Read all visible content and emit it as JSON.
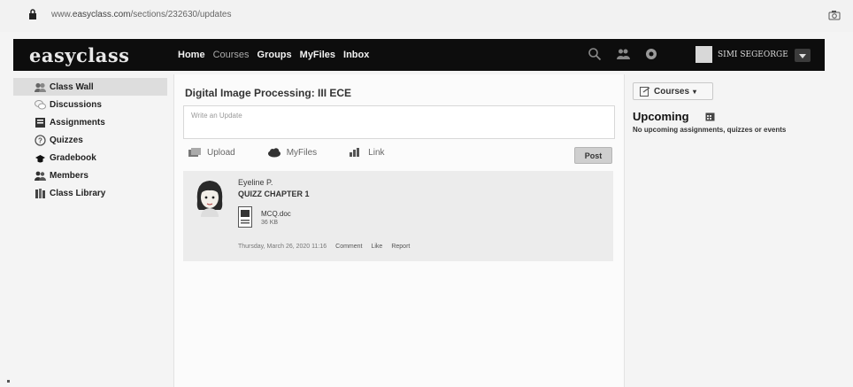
{
  "browser": {
    "url_prefix": "www.",
    "url_domain": "easyclass.com",
    "url_path": "/sections/232630/updates"
  },
  "navbar": {
    "logo": "easyclass",
    "links": [
      "Home",
      "Courses",
      "Groups",
      "MyFiles",
      "Inbox"
    ],
    "user_name": "SIMI SEGEORGE"
  },
  "sidebar": {
    "items": [
      {
        "label": "Class Wall",
        "icon": "class-wall-icon"
      },
      {
        "label": "Discussions",
        "icon": "discussions-icon"
      },
      {
        "label": "Assignments",
        "icon": "assignments-icon"
      },
      {
        "label": "Quizzes",
        "icon": "quizzes-icon"
      },
      {
        "label": "Gradebook",
        "icon": "gradebook-icon"
      },
      {
        "label": "Members",
        "icon": "members-icon"
      },
      {
        "label": "Class Library",
        "icon": "class-library-icon"
      }
    ]
  },
  "main": {
    "course_title": "Digital Image Processing: III ECE",
    "update_placeholder": "Write an Update",
    "actions": {
      "upload": "Upload",
      "myfiles": "MyFiles",
      "link": "Link"
    },
    "post_button": "Post",
    "post": {
      "author": "Eyeline P.",
      "title": "QUIZZ CHAPTER 1",
      "attachment": {
        "name": "MCQ.doc",
        "size": "36 KB"
      },
      "timestamp": "Thursday, March 26, 2020 11:16",
      "comment": "Comment",
      "like": "Like",
      "report": "Report"
    }
  },
  "right": {
    "courses_button": "Courses",
    "upcoming_heading": "Upcoming",
    "upcoming_empty": "No upcoming assignments, quizzes or events"
  }
}
